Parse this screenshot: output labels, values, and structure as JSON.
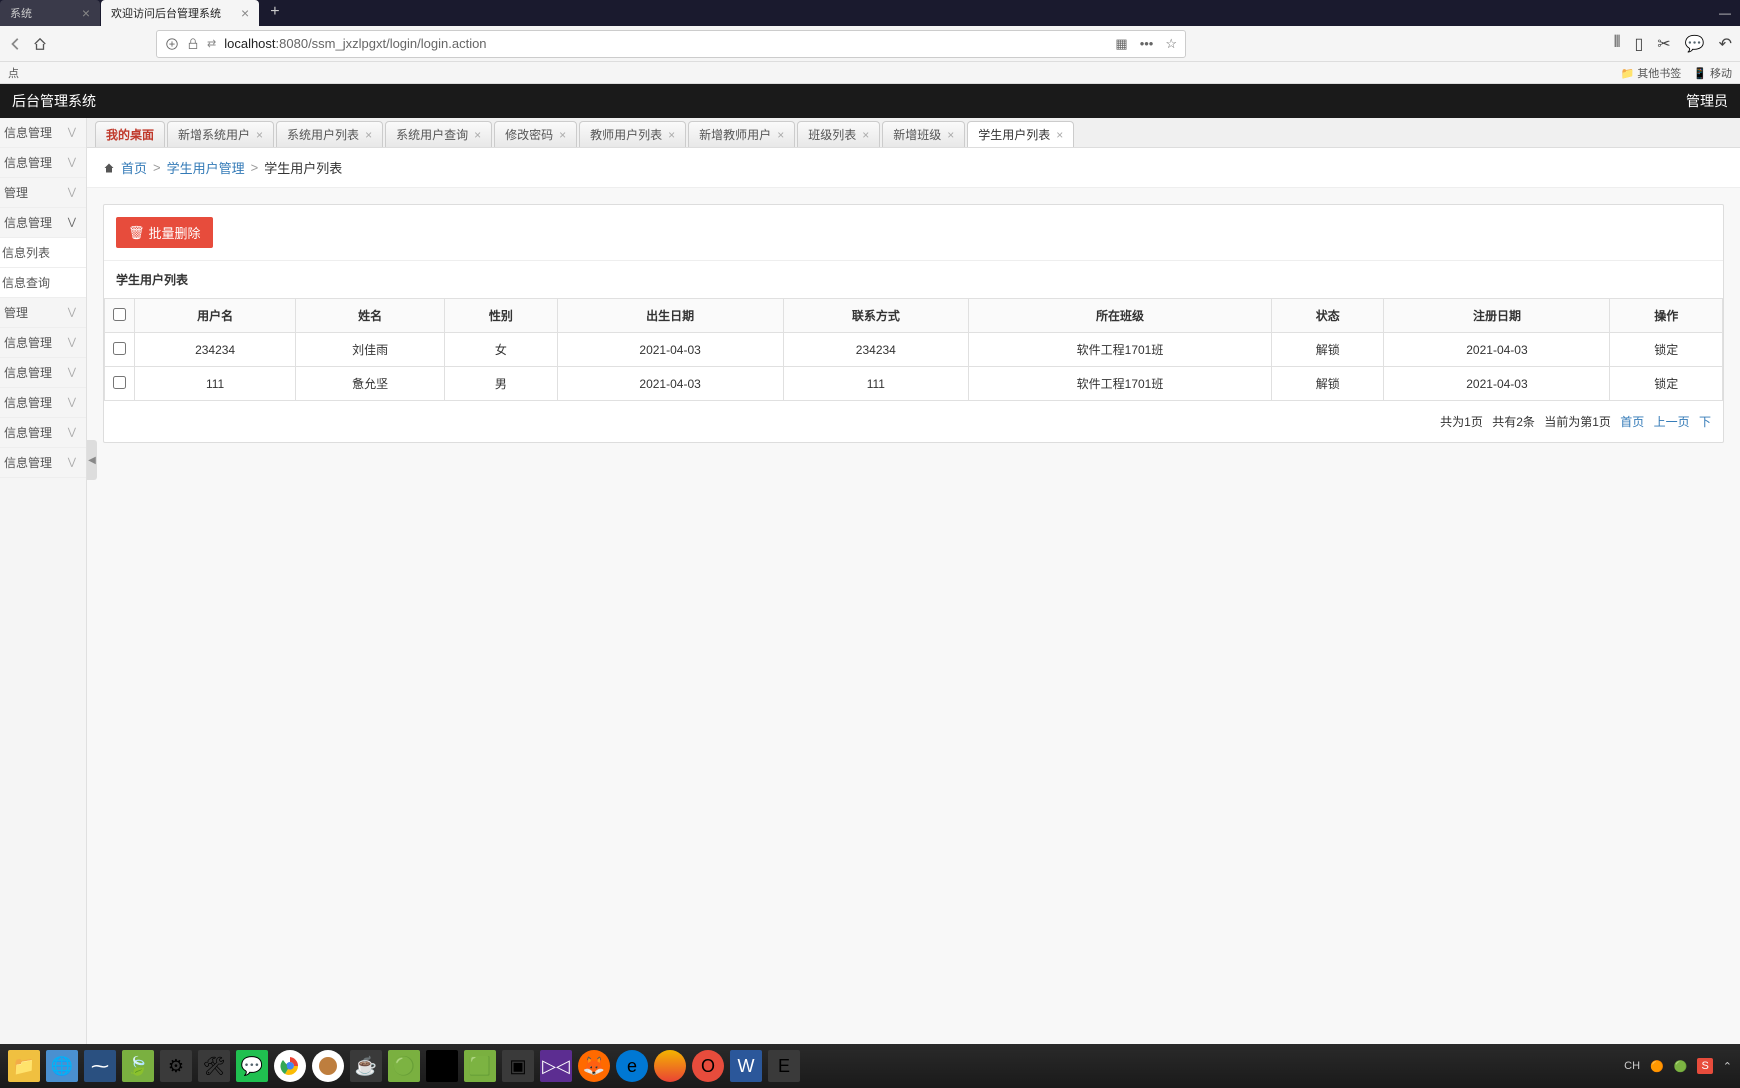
{
  "browser": {
    "tabs": [
      {
        "label": "系统",
        "active": false
      },
      {
        "label": "欢迎访问后台管理系统",
        "active": true
      }
    ],
    "url_host": "localhost",
    "url_path": ":8080/ssm_jxzlpgxt/login/login.action",
    "bookmark_left": "点",
    "bookmark_other": "其他书签",
    "bookmark_mobile": "移动"
  },
  "app": {
    "title": "后台管理系统",
    "admin": "管理员"
  },
  "sidebar": {
    "items": [
      {
        "label": "信息管理",
        "expanded": false
      },
      {
        "label": "信息管理",
        "expanded": false
      },
      {
        "label": "管理",
        "expanded": false
      },
      {
        "label": "信息管理",
        "expanded": true
      },
      {
        "label": "信息列表",
        "sub": true
      },
      {
        "label": "信息查询",
        "sub": true
      },
      {
        "label": "管理",
        "expanded": false
      },
      {
        "label": "信息管理",
        "expanded": false
      },
      {
        "label": "信息管理",
        "expanded": false
      },
      {
        "label": "信息管理",
        "expanded": false
      },
      {
        "label": "信息管理",
        "expanded": false
      },
      {
        "label": "信息管理",
        "expanded": false
      }
    ]
  },
  "tabs": [
    {
      "label": "我的桌面",
      "home": true
    },
    {
      "label": "新增系统用户"
    },
    {
      "label": "系统用户列表"
    },
    {
      "label": "系统用户查询"
    },
    {
      "label": "修改密码"
    },
    {
      "label": "教师用户列表"
    },
    {
      "label": "新增教师用户"
    },
    {
      "label": "班级列表"
    },
    {
      "label": "新增班级"
    },
    {
      "label": "学生用户列表",
      "active": true
    }
  ],
  "crumbs": {
    "home": "首页",
    "level1": "学生用户管理",
    "level2": "学生用户列表"
  },
  "panel": {
    "batch_delete": "批量删除",
    "title": "学生用户列表"
  },
  "table": {
    "headers": [
      "用户名",
      "姓名",
      "性别",
      "出生日期",
      "联系方式",
      "所在班级",
      "状态",
      "注册日期",
      "操作"
    ],
    "rows": [
      {
        "cells": [
          "234234",
          "刘佳雨",
          "女",
          "2021-04-03",
          "234234",
          "软件工程1701班",
          "解锁",
          "2021-04-03",
          "锁定"
        ]
      },
      {
        "cells": [
          "111",
          "惫允坚",
          "男",
          "2021-04-03",
          "111",
          "软件工程1701班",
          "解锁",
          "2021-04-03",
          "锁定"
        ]
      }
    ]
  },
  "pager": {
    "total_pages": "共为1页",
    "total_rows": "共有2条",
    "current": "当前为第1页",
    "first": "首页",
    "prev": "上一页",
    "next": "下"
  },
  "tray": {
    "ime": "CH",
    "s": "S"
  }
}
